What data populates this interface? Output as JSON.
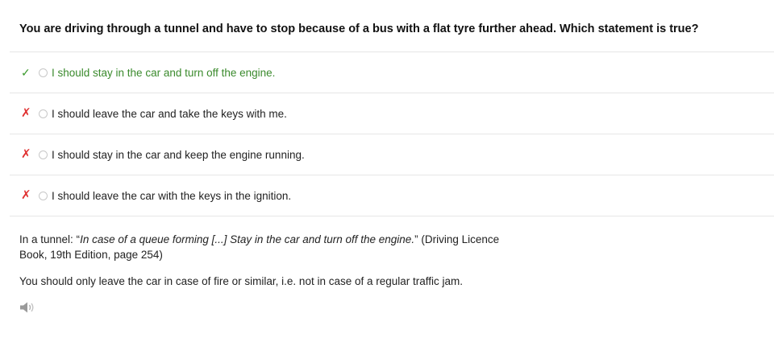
{
  "question": {
    "text": "You are driving through a tunnel and have to stop because of a bus with a flat tyre further ahead. Which statement is true?"
  },
  "answers": [
    {
      "mark_icon": "check-icon",
      "mark": "✓",
      "status": "correct",
      "label": "I should stay in the car and turn off the engine."
    },
    {
      "mark_icon": "cross-icon",
      "mark": "✗",
      "status": "wrong",
      "label": "I should leave the car and take the keys with me."
    },
    {
      "mark_icon": "cross-icon",
      "mark": "✗",
      "status": "wrong",
      "label": "I should stay in the car and keep the engine running."
    },
    {
      "mark_icon": "cross-icon",
      "mark": "✗",
      "status": "wrong",
      "label": "I should leave the car with the keys in the ignition."
    }
  ],
  "explanation": {
    "prefix": "In a tunnel: “",
    "quote": "In case of a queue forming [...] Stay in the car and turn off the engine.",
    "suffix": "” (Driving Licence Book, 19th Edition, page 254)",
    "note": "You should only leave the car in case of fire or similar, i.e. not in case of a regular traffic jam."
  },
  "audio": {
    "icon": "speaker-icon"
  },
  "colors": {
    "correct": "#3a9a2c",
    "wrong": "#e03131",
    "divider": "#e6e6e6"
  }
}
